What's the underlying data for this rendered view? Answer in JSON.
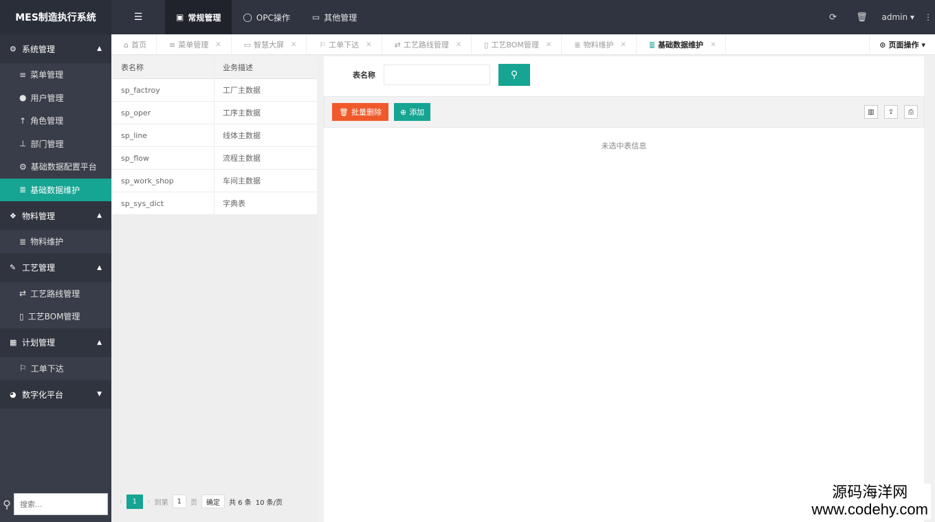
{
  "app": {
    "title": "MES制造执行系统"
  },
  "topnav": {
    "items": [
      {
        "label": "常规管理",
        "icon": "document-icon",
        "active": true
      },
      {
        "label": "OPC操作",
        "icon": "circle-icon",
        "active": false
      },
      {
        "label": "其他管理",
        "icon": "monitor-icon",
        "active": false
      }
    ],
    "user": "admin"
  },
  "sidebar": {
    "groups": [
      {
        "label": "系统管理",
        "items": [
          "菜单管理",
          "用户管理",
          "角色管理",
          "部门管理",
          "基础数据配置平台",
          "基础数据维护"
        ]
      },
      {
        "label": "物料管理",
        "items": [
          "物料维护"
        ]
      },
      {
        "label": "工艺管理",
        "items": [
          "工艺路线管理",
          "工艺BOM管理"
        ]
      },
      {
        "label": "计划管理",
        "items": [
          "工单下达"
        ]
      },
      {
        "label": "数字化平台",
        "items": []
      }
    ],
    "active_item": "基础数据维护",
    "search_placeholder": "搜索..."
  },
  "tabs": {
    "items": [
      "首页",
      "菜单管理",
      "智慧大屏",
      "工单下达",
      "工艺路线管理",
      "工艺BOM管理",
      "物料维护",
      "基础数据维护"
    ],
    "active": "基础数据维护",
    "page_ops": "页面操作"
  },
  "table": {
    "headers": [
      "表名称",
      "业务描述"
    ],
    "rows": [
      [
        "sp_factroy",
        "工厂主数据"
      ],
      [
        "sp_oper",
        "工序主数据"
      ],
      [
        "sp_line",
        "线体主数据"
      ],
      [
        "sp_flow",
        "流程主数据"
      ],
      [
        "sp_work_shop",
        "车间主数据"
      ],
      [
        "sp_sys_dict",
        "字典表"
      ]
    ]
  },
  "pager": {
    "current_page": "1",
    "goto_label": "到第",
    "goto_value": "1",
    "page_unit": "页",
    "confirm": "确定",
    "total": "共 6 条",
    "page_size": "10 条/页"
  },
  "right": {
    "search_label": "表名称",
    "batch_delete": "批量删除",
    "add": "添加",
    "empty_msg": "未选中表信息"
  },
  "watermark": {
    "line1": "源码海洋网",
    "line2": "www.codehy.com"
  }
}
